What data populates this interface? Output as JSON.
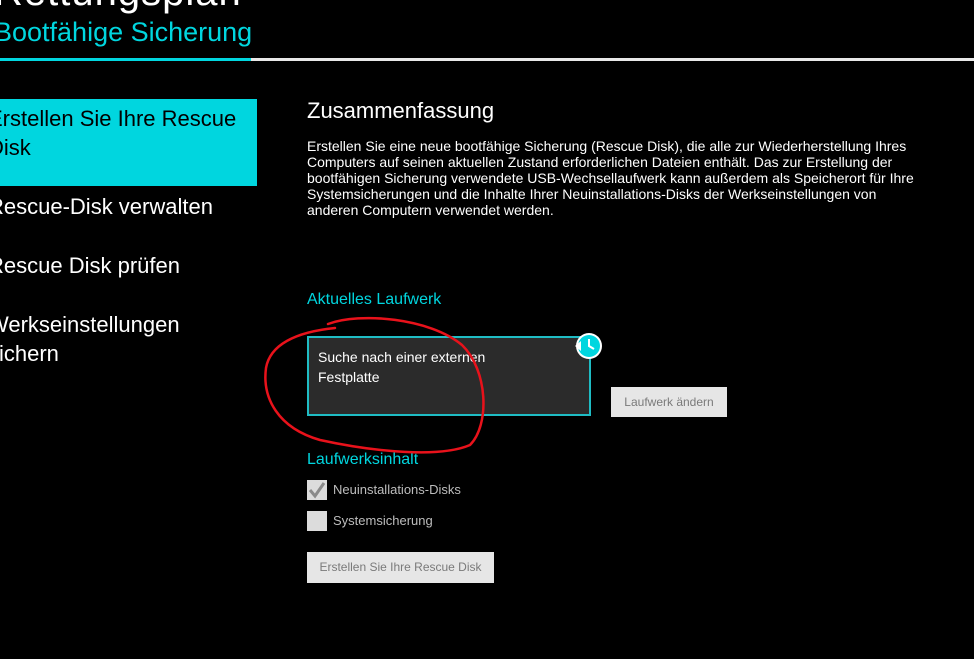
{
  "header": {
    "title": "Rettungsplan",
    "subtitle": "Bootfähige Sicherung"
  },
  "nav": {
    "items": [
      {
        "label": "Erstellen Sie Ihre Rescue\nDisk",
        "active": true
      },
      {
        "label": "Rescue-Disk verwalten",
        "active": false
      },
      {
        "label": "Rescue Disk prüfen",
        "active": false
      },
      {
        "label": "Werkseinstellungen\nsichern",
        "active": false
      }
    ]
  },
  "main": {
    "section_title": "Zusammenfassung",
    "summary_lines": [
      "Erstellen Sie eine neue bootfähige Sicherung (Rescue Disk), die alle zur Wiederherstellung Ihres",
      "Computers auf seinen aktuellen Zustand erforderlichen Dateien enthält. Das zur Erstellung der",
      "bootfähigen Sicherung verwendete USB-Wechsellaufwerk kann außerdem als Speicherort für Ihre",
      "Systemsicherungen und die Inhalte Ihrer Neuinstallations-Disks der Werkseinstellungen von",
      "anderen Computern verwendet werden."
    ],
    "current_drive": {
      "heading": "Aktuelles Laufwerk",
      "status_lines": [
        "Suche nach einer externen",
        "Festplatte"
      ],
      "refresh_icon": "refresh-icon",
      "change_button": "Laufwerk ändern"
    },
    "drive_contents": {
      "heading": "Laufwerksinhalt",
      "options": [
        {
          "label": "Neuinstallations-Disks",
          "checked": true
        },
        {
          "label": "Systemsicherung",
          "checked": false
        }
      ]
    },
    "create_button": "Erstellen Sie Ihre Rescue Disk"
  },
  "colors": {
    "background": "#000000",
    "accent": "#00d6df",
    "annotation": "#e8121b"
  }
}
